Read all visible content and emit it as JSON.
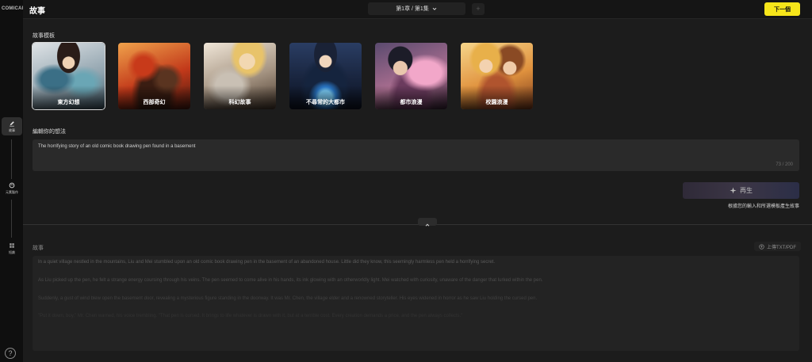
{
  "app": {
    "logo": "COMICAI",
    "title": "故事"
  },
  "rail": {
    "items": [
      {
        "label": "故事",
        "icon": "pen-icon"
      },
      {
        "label": "元素製作",
        "icon": "palette-icon"
      },
      {
        "label": "短劇",
        "icon": "grid-icon"
      }
    ],
    "help": "?"
  },
  "header": {
    "chapter": "第1章 / 第1集",
    "add": "+",
    "next_label": "下一個"
  },
  "templates": {
    "label": "故事模板",
    "items": [
      {
        "label": "東方幻想"
      },
      {
        "label": "西部奇幻"
      },
      {
        "label": "科幻故事"
      },
      {
        "label": "不尋常的大都市"
      },
      {
        "label": "都市浪漫"
      },
      {
        "label": "校園浪漫"
      }
    ]
  },
  "idea": {
    "label": "編輯你的想法",
    "value": "The horrifying story of an old comic book drawing pen found in a basement",
    "count": "73 / 200"
  },
  "generate": {
    "label": "再生",
    "hint": "根據您的輸入和所選模板產生故事"
  },
  "story": {
    "label": "故事",
    "upload_label": "上傳TXT/PDF",
    "paragraphs": [
      "In a quiet village nestled in the mountains, Liu and Mei stumbled upon an old comic book drawing pen in the basement of an abandoned house. Little did they know, this seemingly harmless pen held a horrifying secret.",
      "As Liu picked up the pen, he felt a strange energy coursing through his veins. The pen seemed to come alive in his hands, its ink glowing with an otherworldly light. Mei watched with curiosity, unaware of the danger that lurked within the pen.",
      "Suddenly, a gust of wind blew open the basement door, revealing a mysterious figure standing in the doorway. It was Mr. Chen, the village elder and a renowned storyteller. His eyes widened in horror as he saw Liu holding the cursed pen.",
      "\"Put it down, boy,\" Mr. Chen warned, his voice trembling. \"That pen is cursed. It brings to life whatever is drawn with it, but at a terrible cost. Every creation demands a price, and the pen always collects.\""
    ]
  }
}
